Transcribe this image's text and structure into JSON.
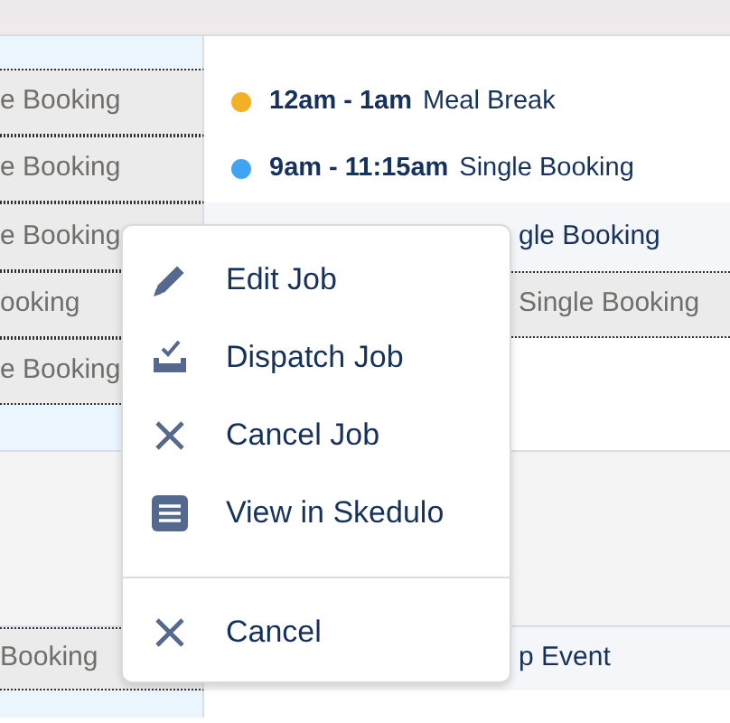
{
  "rows": [
    {
      "left": "e Booking",
      "right": {
        "kind": "event",
        "time": "12am - 1am",
        "title": "Meal Break",
        "color": "#f4b128"
      }
    },
    {
      "left": "e Booking",
      "right": {
        "kind": "event",
        "time": "9am - 11:15am",
        "title": "Single Booking",
        "color": "#3fa4f4"
      }
    },
    {
      "left": "e Booking",
      "right": {
        "kind": "clipped",
        "text": "gle Booking",
        "shaded": false
      }
    },
    {
      "left": "ooking",
      "right": {
        "kind": "clipped",
        "text": "Single Booking",
        "shaded": true
      }
    },
    {
      "left": "e Booking",
      "right": {
        "kind": "blank"
      }
    }
  ],
  "lower_rows": [
    {
      "left": "Booking",
      "right": {
        "kind": "clipped",
        "text": "p Event",
        "shaded": false
      }
    }
  ],
  "context_menu": {
    "items": [
      {
        "kind": "edit",
        "label": "Edit Job"
      },
      {
        "kind": "dispatch",
        "label": "Dispatch Job"
      },
      {
        "kind": "cancel",
        "label": "Cancel Job"
      },
      {
        "kind": "view",
        "label": "View in Skedulo"
      }
    ],
    "footer_items": [
      {
        "kind": "cancel",
        "label": "Cancel"
      }
    ]
  }
}
